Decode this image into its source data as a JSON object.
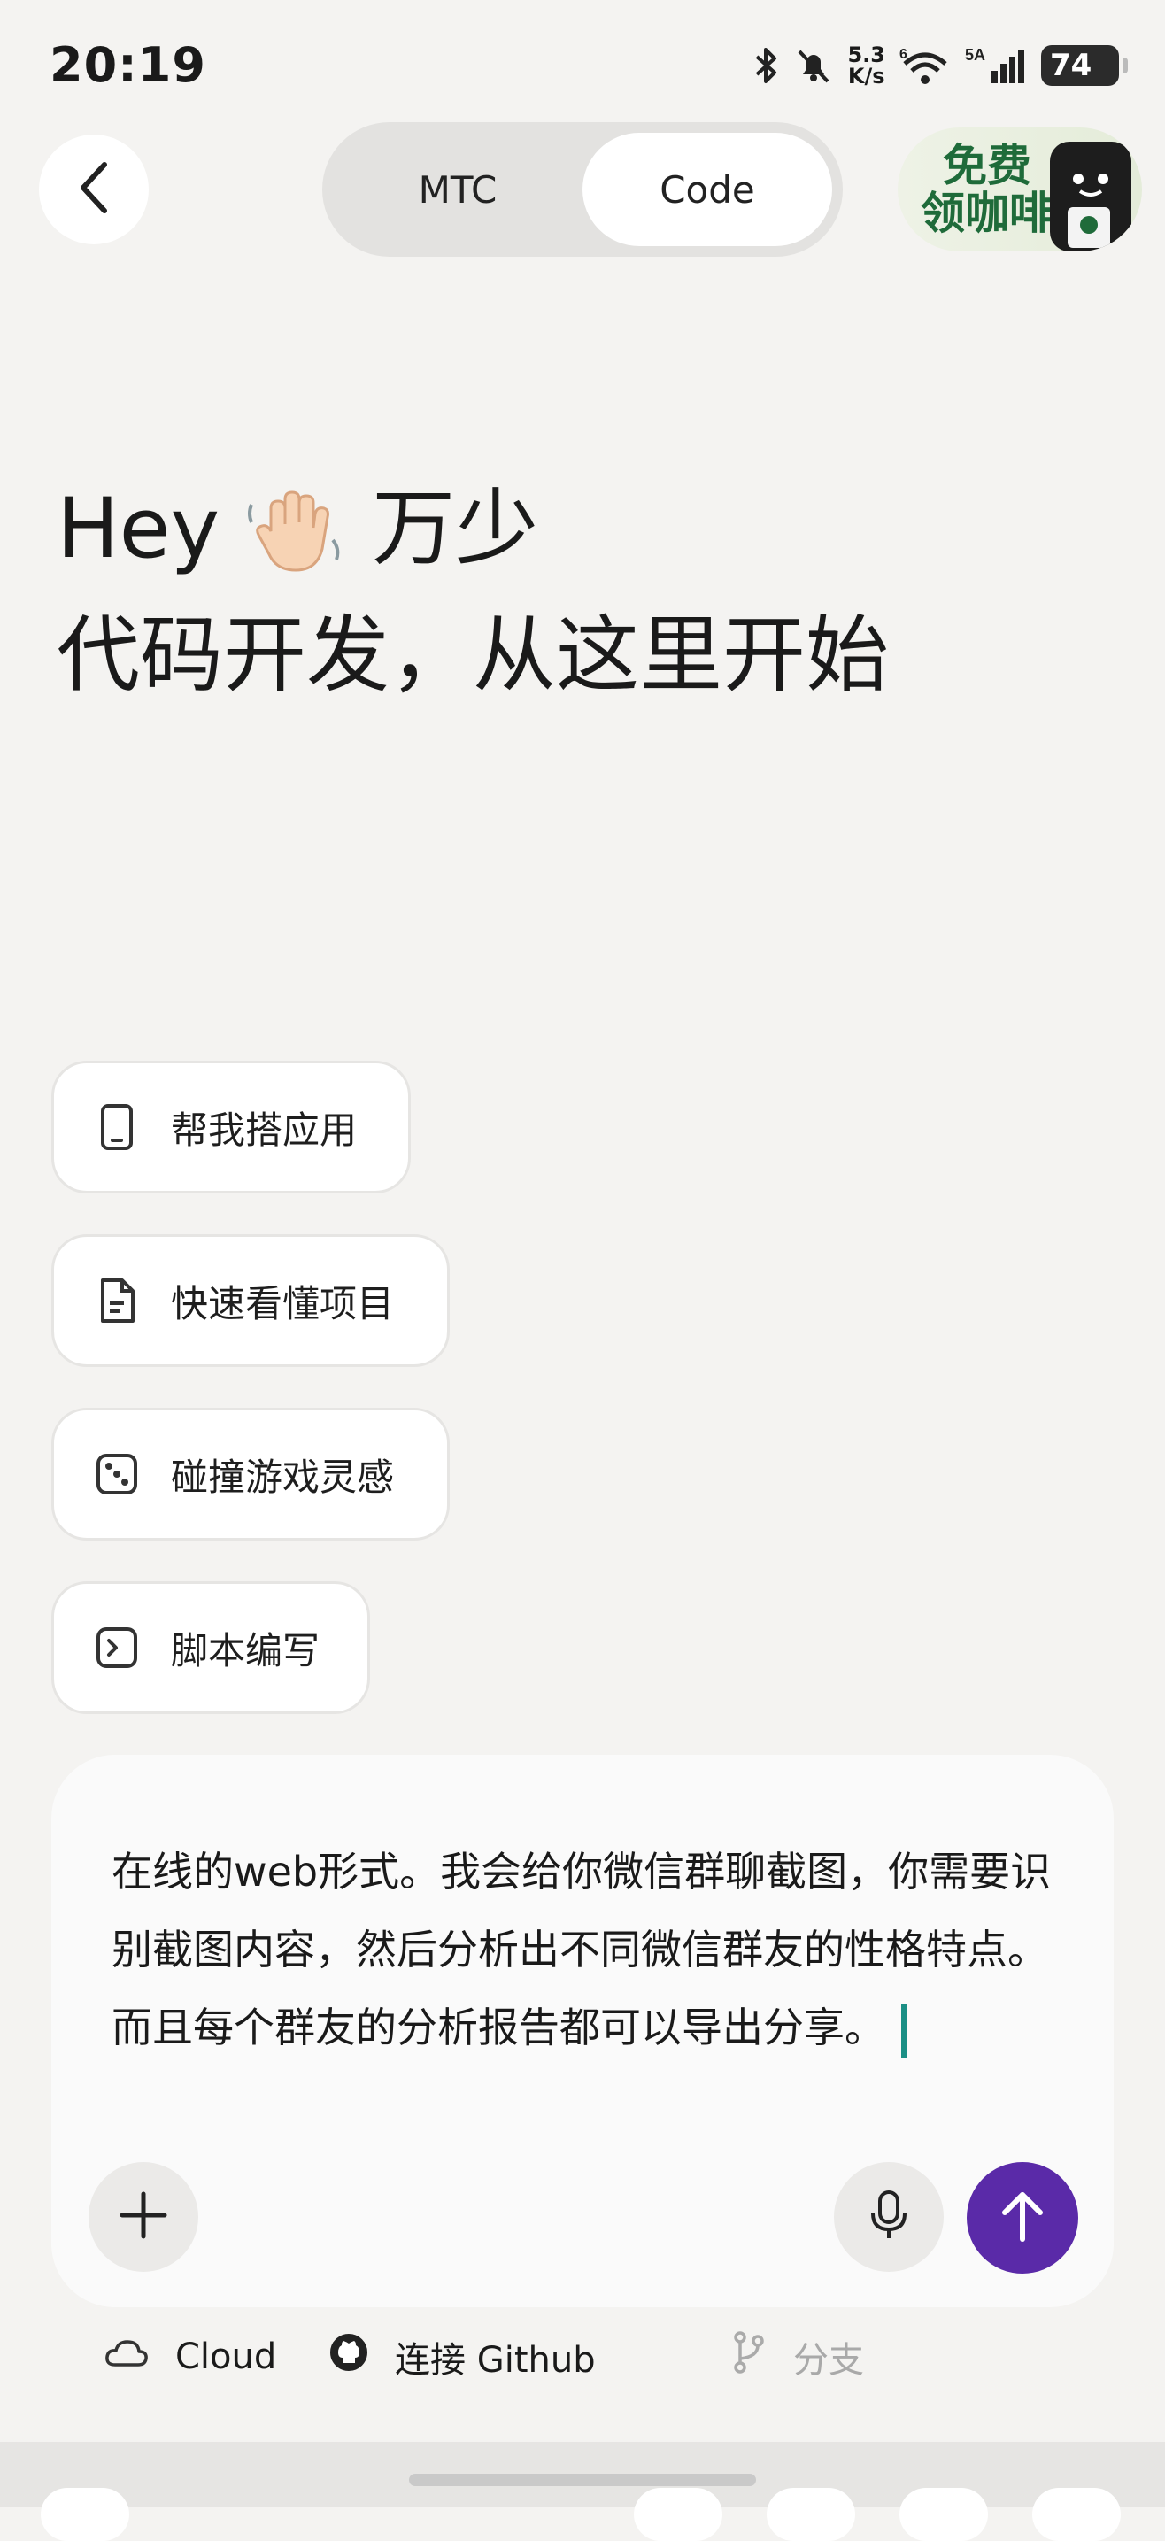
{
  "status_bar": {
    "time": "20:19",
    "net_speed_value": "5.3",
    "net_speed_unit": "K/s",
    "wifi_label": "6",
    "signal_label": "5A",
    "battery": "74"
  },
  "header": {
    "tabs": [
      {
        "label": "MTC",
        "active": false
      },
      {
        "label": "Code",
        "active": true
      }
    ],
    "promo": {
      "line1": "免费",
      "line2": "领咖啡"
    }
  },
  "greeting": {
    "prefix": "Hey",
    "name": "万少",
    "subtitle": "代码开发，从这里开始"
  },
  "suggestions": [
    {
      "label": "帮我搭应用",
      "icon": "phone-icon"
    },
    {
      "label": "快速看懂项目",
      "icon": "document-icon"
    },
    {
      "label": "碰撞游戏灵感",
      "icon": "dice-icon"
    },
    {
      "label": "脚本编写",
      "icon": "terminal-icon"
    }
  ],
  "composer": {
    "text": "在线的web形式。我会给你微信群聊截图，你需要识别截图内容，然后分析出不同微信群友的性格特点。而且每个群友的分析报告都可以导出分享。"
  },
  "footer": {
    "cloud_label": "Cloud",
    "github_label": "连接 Github",
    "branch_label": "分支"
  },
  "colors": {
    "background": "#f4f3f1",
    "send_button": "#5a2aa8",
    "caret": "#1b8f85",
    "promo_text": "#1f6b3a"
  }
}
